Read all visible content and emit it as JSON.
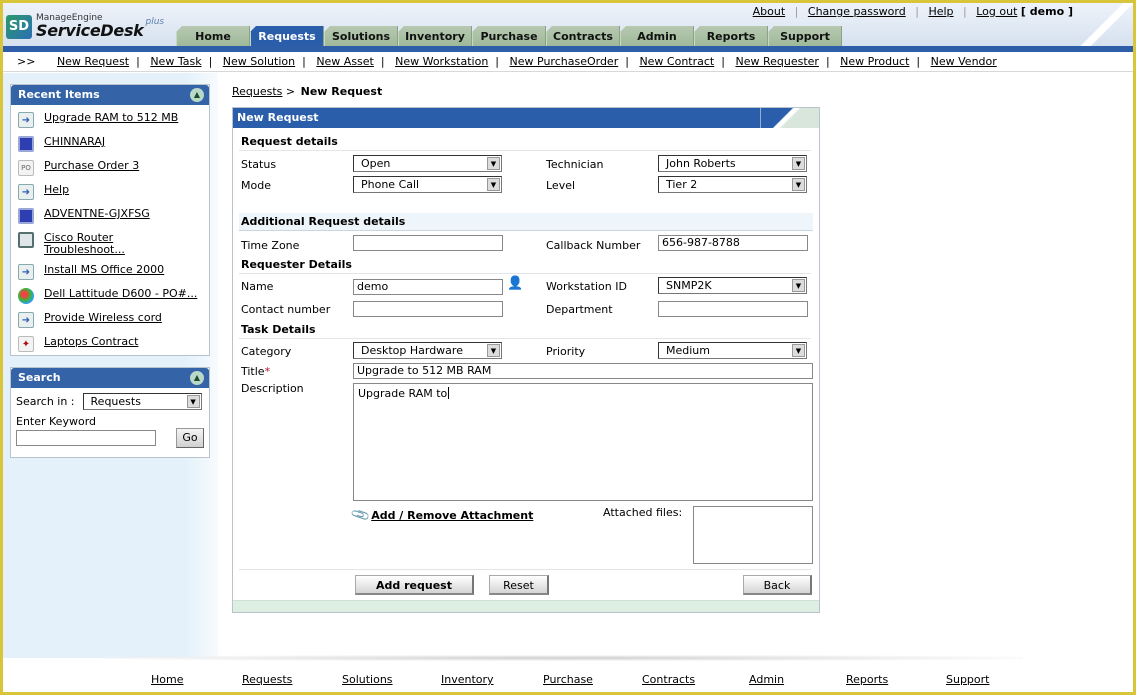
{
  "app": {
    "brand_small": "ManageEngine",
    "brand_big": "ServiceDesk",
    "brand_plus": "plus"
  },
  "toplinks": {
    "about": "About",
    "change_password": "Change password",
    "help": "Help",
    "logout": "Log out",
    "user": "[ demo ]",
    "separator": "|"
  },
  "tabs": [
    {
      "label": "Home",
      "active": false
    },
    {
      "label": "Requests",
      "active": true
    },
    {
      "label": "Solutions",
      "active": false
    },
    {
      "label": "Inventory",
      "active": false
    },
    {
      "label": "Purchase",
      "active": false
    },
    {
      "label": "Contracts",
      "active": false
    },
    {
      "label": "Admin",
      "active": false
    },
    {
      "label": "Reports",
      "active": false
    },
    {
      "label": "Support",
      "active": false
    }
  ],
  "quicklinks": {
    "prefix": ">>",
    "separator": "|",
    "items": [
      "New Request",
      "New Task",
      "New Solution",
      "New Asset",
      "New Workstation",
      "New PurchaseOrder",
      "New Contract",
      "New Requester",
      "New Product",
      "New Vendor"
    ]
  },
  "recent_items": {
    "title": "Recent Items",
    "collapse_icon": "double-chevron-up",
    "items": [
      {
        "label": "Upgrade RAM to 512 MB",
        "icon": "request-icon"
      },
      {
        "label": "CHINNARAJ",
        "icon": "workstation-icon"
      },
      {
        "label": "Purchase Order 3",
        "icon": "purchase-order-icon"
      },
      {
        "label": "Help",
        "icon": "request-icon"
      },
      {
        "label": "ADVENTNE-GJXFSG",
        "icon": "workstation-icon"
      },
      {
        "label": "Cisco Router Troubleshoot...",
        "icon": "router-icon"
      },
      {
        "label": "Install MS Office 2000",
        "icon": "request-icon"
      },
      {
        "label": "Dell Lattitude D600 - PO#...",
        "icon": "product-icon"
      },
      {
        "label": "Provide Wireless cord",
        "icon": "request-icon"
      },
      {
        "label": "Laptops Contract",
        "icon": "contract-icon"
      }
    ]
  },
  "search": {
    "title": "Search",
    "search_in_label": "Search in :",
    "search_in_value": "Requests",
    "keyword_label": "Enter Keyword",
    "keyword_value": "",
    "go_label": "Go"
  },
  "breadcrumb": {
    "parent": "Requests",
    "separator": ">",
    "current": "New Request"
  },
  "form": {
    "title": "New Request",
    "request_details": {
      "heading": "Request details",
      "status_label": "Status",
      "status_value": "Open",
      "mode_label": "Mode",
      "mode_value": "Phone Call",
      "technician_label": "Technician",
      "technician_value": "John Roberts",
      "level_label": "Level",
      "level_value": "Tier 2"
    },
    "additional": {
      "heading": "Additional Request details",
      "timezone_label": "Time Zone",
      "timezone_value": "",
      "callback_label": "Callback Number",
      "callback_value": "656-987-8788"
    },
    "requester": {
      "heading": "Requester Details",
      "name_label": "Name",
      "name_value": "demo",
      "workstation_label": "Workstation ID",
      "workstation_value": "SNMP2K",
      "contact_label": "Contact number",
      "contact_value": "",
      "department_label": "Department",
      "department_value": ""
    },
    "task": {
      "heading": "Task Details",
      "category_label": "Category",
      "category_value": "Desktop Hardware",
      "priority_label": "Priority",
      "priority_value": "Medium",
      "title_label": "Title",
      "title_required": "*",
      "title_value": "Upgrade to 512 MB RAM",
      "description_label": "Description",
      "description_value": "Upgrade RAM to"
    },
    "attachment_link": "Add / Remove Attachment",
    "attached_files_label": "Attached files:",
    "buttons": {
      "add": "Add request",
      "reset": "Reset",
      "back": "Back"
    }
  },
  "footer": {
    "links": [
      "Home",
      "Requests",
      "Solutions",
      "Inventory",
      "Purchase",
      "Contracts",
      "Admin",
      "Reports",
      "Support"
    ]
  },
  "colors": {
    "accent_blue": "#2a5daa",
    "tab_green": "#a8bfa3",
    "frame_yellow": "#d9c53a",
    "sidebar_bg": "#e5f1fa"
  }
}
